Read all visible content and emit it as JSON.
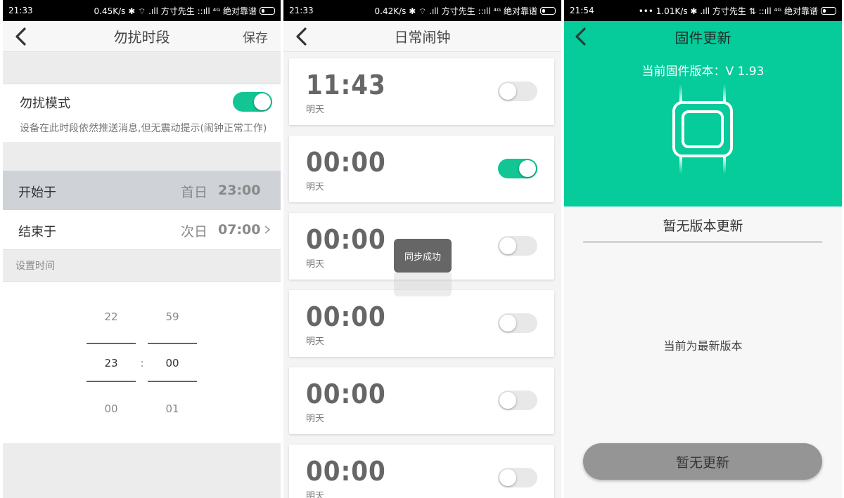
{
  "status_bar": [
    {
      "time": "21:33",
      "right": "0.45K/s ✱ ⌔ .ıll 方寸先生 ::ıll ⁴ᴳ 绝对靠谱"
    },
    {
      "time": "21:33",
      "right": "0.42K/s ✱ ⌔ .ıll 方寸先生 ::ıll ⁴ᴳ 绝对靠谱"
    },
    {
      "time": "21:54",
      "right": "••• 1.01K/s ✱ .ıll 方寸先生 ⇅ ::ıll ⁴ᴳ 绝对靠谱"
    }
  ],
  "dnd": {
    "title": "勿扰时段",
    "save_label": "保存",
    "mode_label": "勿扰模式",
    "mode_on": true,
    "mode_desc": "设备在此时段依然推送消息,但无震动提示(闹钟正常工作)",
    "start_label": "开始于",
    "start_day": "首日",
    "start_time": "23:00",
    "end_label": "结束于",
    "end_day": "次日",
    "end_time": "07:00",
    "section_label": "设置时间",
    "picker": {
      "hour_prev": "22",
      "hour_sel": "23",
      "hour_next": "00",
      "min_prev": "59",
      "min_sel": "00",
      "min_next": "01",
      "separator": ":"
    }
  },
  "alarms": {
    "title": "日常闹钟",
    "items": [
      {
        "time": "11:43",
        "day": "明天",
        "on": false
      },
      {
        "time": "00:00",
        "day": "明天",
        "on": true
      },
      {
        "time": "00:00",
        "day": "明天",
        "on": false
      },
      {
        "time": "00:00",
        "day": "明天",
        "on": false
      },
      {
        "time": "00:00",
        "day": "明天",
        "on": false
      },
      {
        "time": "00:00",
        "day": "明天",
        "on": false
      }
    ],
    "toast": "同步成功"
  },
  "firmware": {
    "title": "固件更新",
    "current_version": "当前固件版本：V 1.93",
    "status": "暂无版本更新",
    "message": "当前为最新版本",
    "button_label": "暂无更新"
  },
  "colors": {
    "accent": "#12c592",
    "hero": "#06cb9a",
    "button_gray": "#959595"
  }
}
